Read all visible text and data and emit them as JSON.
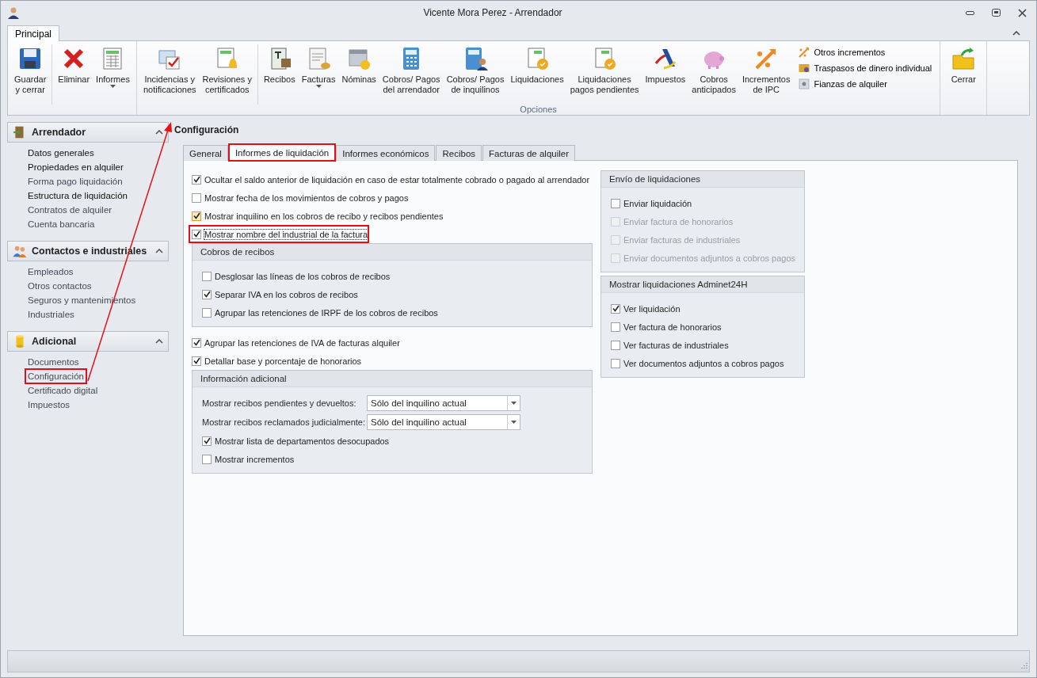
{
  "window": {
    "title": "Vicente Mora Perez - Arrendador"
  },
  "ribbon": {
    "tabs": [
      {
        "label": "Principal",
        "selected": true
      }
    ],
    "groups": [
      {
        "buttons": [
          {
            "label": "Guardar\ny cerrar",
            "kind": "floppy",
            "dropdown": false,
            "separator_before": false
          },
          {
            "label": "Eliminar",
            "kind": "delete",
            "dropdown": false,
            "separator_before": true
          },
          {
            "label": "Informes",
            "kind": "sheet",
            "dropdown": true,
            "separator_before": false
          }
        ]
      },
      {
        "label": "Opciones",
        "buttons": [
          {
            "label": "Incidencias y\nnotificaciones",
            "kind": "envelope",
            "dropdown": false,
            "separator_before": false
          },
          {
            "label": "Revisiones y\ncertificados",
            "kind": "bell",
            "dropdown": false,
            "separator_before": false
          },
          {
            "label": "Recibos",
            "kind": "receipt",
            "dropdown": false,
            "separator_before": true
          },
          {
            "label": "Facturas",
            "kind": "invoice",
            "dropdown": true,
            "separator_before": false
          },
          {
            "label": "Nóminas",
            "kind": "calendar",
            "dropdown": false,
            "separator_before": false
          },
          {
            "label": "Cobros/ Pagos\ndel arrendador",
            "kind": "calculator",
            "dropdown": false,
            "separator_before": false
          },
          {
            "label": "Cobros/ Pagos\nde inquilinos",
            "kind": "calculator-person",
            "dropdown": false,
            "separator_before": false
          },
          {
            "label": "Liquidaciones",
            "kind": "seal",
            "dropdown": false,
            "separator_before": false
          },
          {
            "label": "Liquidaciones\npagos pendientes",
            "kind": "seal",
            "dropdown": false,
            "separator_before": false
          },
          {
            "label": "Impuestos",
            "kind": "mark",
            "dropdown": false,
            "separator_before": false
          },
          {
            "label": "Cobros\nanticipados",
            "kind": "piggy",
            "dropdown": false,
            "separator_before": false
          },
          {
            "label": "Incrementos\nde IPC",
            "kind": "arrows",
            "dropdown": false,
            "separator_before": false
          }
        ],
        "small_buttons": [
          {
            "label": "Otros incrementos",
            "kind": "arrows"
          },
          {
            "label": "Traspasos de dinero individual",
            "kind": "transfer"
          },
          {
            "label": "Fianzas de alquiler",
            "kind": "safe"
          }
        ]
      },
      {
        "buttons": [
          {
            "label": "Cerrar",
            "kind": "folder",
            "dropdown": false,
            "separator_before": false
          }
        ]
      }
    ]
  },
  "sidebar": {
    "sections": [
      {
        "title": "Arrendador",
        "kind": "door",
        "expanded": true,
        "items": [
          {
            "label": "Datos generales",
            "dim": false,
            "highlighted": false
          },
          {
            "label": "Propiedades en alquiler",
            "dim": false,
            "highlighted": false
          },
          {
            "label": "Forma pago liquidación",
            "dim": true,
            "highlighted": false
          },
          {
            "label": "Estructura de liquidación",
            "dim": false,
            "highlighted": false
          },
          {
            "label": "Contratos de alquiler",
            "dim": true,
            "highlighted": false
          },
          {
            "label": "Cuenta bancaria",
            "dim": true,
            "highlighted": false
          }
        ]
      },
      {
        "title": "Contactos e industriales",
        "kind": "people",
        "expanded": true,
        "items": [
          {
            "label": "Empleados",
            "dim": true,
            "highlighted": false
          },
          {
            "label": "Otros contactos",
            "dim": true,
            "highlighted": false
          },
          {
            "label": "Seguros y mantenimientos",
            "dim": true,
            "highlighted": false
          },
          {
            "label": "Industriales",
            "dim": true,
            "highlighted": false
          }
        ]
      },
      {
        "title": "Adicional",
        "kind": "cylinder",
        "expanded": true,
        "items": [
          {
            "label": "Documentos",
            "dim": true,
            "highlighted": false
          },
          {
            "label": "Configuración",
            "dim": true,
            "highlighted": true
          },
          {
            "label": "Certificado digital",
            "dim": true,
            "highlighted": false
          },
          {
            "label": "Impuestos",
            "dim": true,
            "highlighted": false
          }
        ]
      }
    ]
  },
  "annotation": {
    "arrow": true
  },
  "main": {
    "title": "Configuración",
    "tabs": [
      {
        "label": "General",
        "selected": false,
        "highlighted": false
      },
      {
        "label": "Informes de liquidación",
        "selected": true,
        "highlighted": true
      },
      {
        "label": "Informes económicos",
        "selected": false,
        "highlighted": false
      },
      {
        "label": "Recibos",
        "selected": false,
        "highlighted": false
      },
      {
        "label": "Facturas de alquiler",
        "selected": false,
        "highlighted": false
      }
    ],
    "left": [
      {
        "kind": "checkbox",
        "label": "Ocultar el saldo anterior de liquidación en caso de estar totalmente cobrado o pagado al arrendador",
        "checked": true,
        "hover": false,
        "highlighted": false
      },
      {
        "kind": "checkbox",
        "label": "Mostrar fecha de los movimientos de cobros y pagos",
        "checked": false,
        "hover": false,
        "highlighted": false
      },
      {
        "kind": "checkbox",
        "label": "Mostrar inquilino en los cobros de recibo y recibos pendientes",
        "checked": true,
        "hover": true,
        "highlighted": false
      },
      {
        "kind": "checkbox",
        "label": "Mostrar nombre del industrial de la factura",
        "checked": true,
        "hover": false,
        "highlighted": true
      },
      {
        "kind": "group",
        "title": "Cobros de recibos",
        "items": [
          {
            "kind": "checkbox",
            "label": "Desglosar las líneas de los cobros de recibos",
            "checked": false
          },
          {
            "kind": "checkbox",
            "label": "Separar IVA en los cobros de recibos",
            "checked": true
          },
          {
            "kind": "checkbox",
            "label": "Agrupar las retenciones de IRPF de los cobros de recibos",
            "checked": false
          }
        ]
      },
      {
        "kind": "checkbox",
        "label": "Agrupar las retenciones de IVA de facturas alquiler",
        "checked": true,
        "hover": false,
        "highlighted": false
      },
      {
        "kind": "checkbox",
        "label": "Detallar base y porcentaje de honorarios",
        "checked": true,
        "hover": false,
        "highlighted": false
      },
      {
        "kind": "group",
        "title": "Información adicional",
        "items": [
          {
            "kind": "select",
            "label": "Mostrar recibos pendientes y devueltos:",
            "value": "Sólo del inquilino actual"
          },
          {
            "kind": "select",
            "label": "Mostrar recibos reclamados judicialmente:",
            "value": "Sólo del inquilino actual"
          },
          {
            "kind": "checkbox",
            "label": "Mostrar lista de departamentos desocupados",
            "checked": true
          },
          {
            "kind": "checkbox",
            "label": "Mostrar incrementos",
            "checked": false
          }
        ]
      }
    ],
    "right": [
      {
        "title": "Envío de liquidaciones",
        "items": [
          {
            "label": "Enviar liquidación",
            "checked": false,
            "disabled": false
          },
          {
            "label": "Enviar factura de honorarios",
            "checked": false,
            "disabled": true
          },
          {
            "label": "Enviar facturas de industriales",
            "checked": false,
            "disabled": true
          },
          {
            "label": "Enviar documentos adjuntos a cobros pagos",
            "checked": false,
            "disabled": true
          }
        ]
      },
      {
        "title": "Mostrar liquidaciones Adminet24H",
        "items": [
          {
            "label": "Ver liquidación",
            "checked": true,
            "disabled": false
          },
          {
            "label": "Ver factura de honorarios",
            "checked": false,
            "disabled": false
          },
          {
            "label": "Ver facturas de industriales",
            "checked": false,
            "disabled": false
          },
          {
            "label": "Ver documentos adjuntos a cobros pagos",
            "checked": false,
            "disabled": false
          }
        ]
      }
    ]
  }
}
